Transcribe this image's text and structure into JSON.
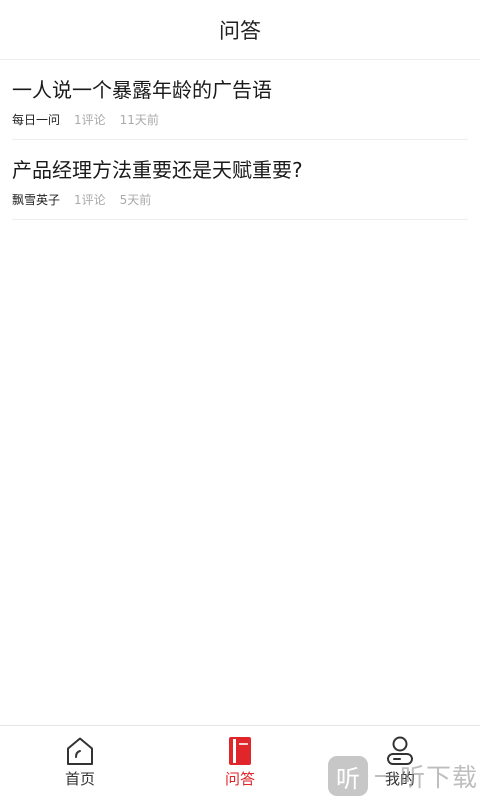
{
  "header": {
    "title": "问答"
  },
  "questions": [
    {
      "title": "一人说一个暴露年龄的广告语",
      "author": "每日一问",
      "comments": "1评论",
      "time": "11天前"
    },
    {
      "title": "产品经理方法重要还是天赋重要?",
      "author": "飘雪英子",
      "comments": "1评论",
      "time": "5天前"
    }
  ],
  "tabbar": {
    "items": [
      {
        "label": "首页",
        "icon": "home-icon"
      },
      {
        "label": "问答",
        "icon": "qa-book-icon",
        "active": true
      },
      {
        "label": "我的",
        "icon": "user-icon"
      }
    ]
  },
  "watermark": {
    "logo": "听",
    "text": "一听下载"
  },
  "colors": {
    "accent": "#e0262b",
    "text": "#1a1a1a",
    "meta": "#aaaaaa"
  }
}
